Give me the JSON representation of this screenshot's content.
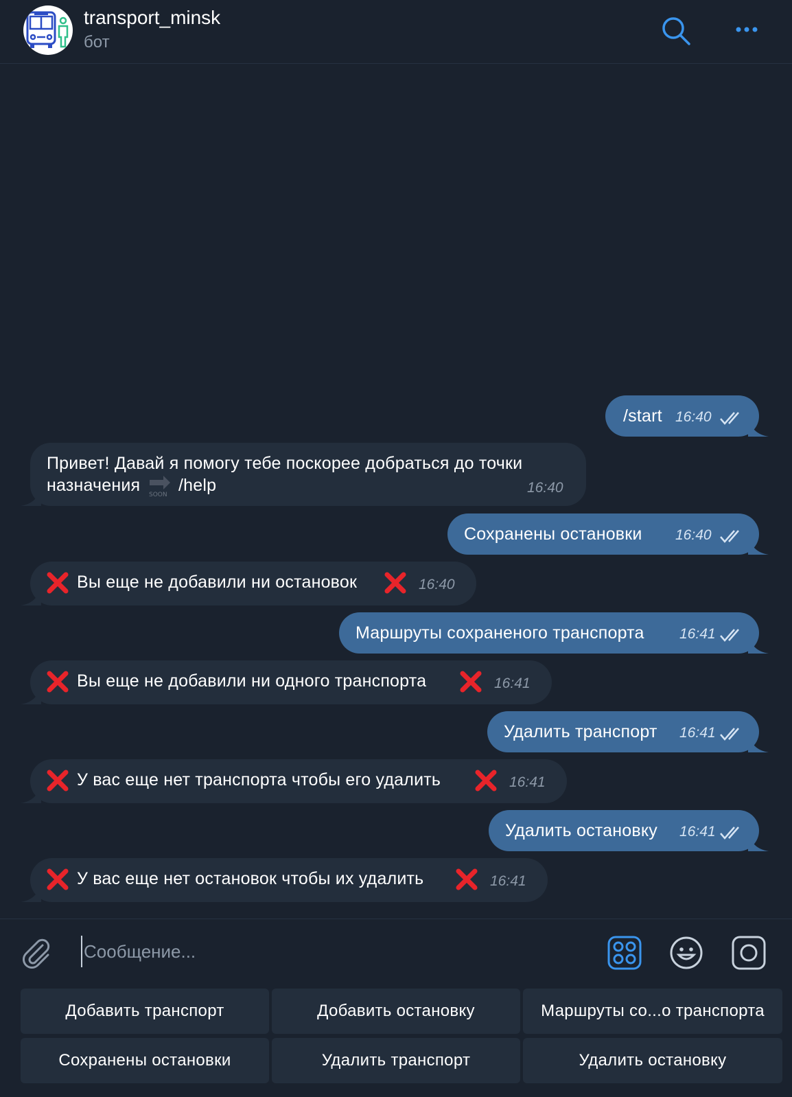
{
  "header": {
    "title": "transport_minsk",
    "subtitle": "бот",
    "search_icon": "search-icon",
    "more_icon": "more-dots-icon"
  },
  "messages": [
    {
      "dir": "out",
      "text": "/start",
      "time": "16:40",
      "is_command": true
    },
    {
      "dir": "in",
      "line1": "Привет! Давай я помогу тебе поскорее добраться до точки",
      "line2": "назначения",
      "emoji": "soon-arrow-emoji",
      "emoji_text": "SOON",
      "link": "/help",
      "time": "16:40"
    },
    {
      "dir": "out",
      "text": "Сохранены остановки",
      "time": "16:40"
    },
    {
      "dir": "in",
      "text": "Вы еще не добавили ни остановок",
      "time": "16:40"
    },
    {
      "dir": "out",
      "text": "Маршруты сохраненого транспорта",
      "time": "16:41"
    },
    {
      "dir": "in",
      "text": "Вы еще не добавили ни одного транспорта",
      "time": "16:41"
    },
    {
      "dir": "out",
      "text": "Удалить транспорт",
      "time": "16:41"
    },
    {
      "dir": "in",
      "text": "У вас еще нет транспорта чтобы его удалить",
      "time": "16:41"
    },
    {
      "dir": "out",
      "text": "Удалить остановку",
      "time": "16:41"
    },
    {
      "dir": "in",
      "text": "У вас еще нет остановок чтобы их удалить",
      "time": "16:41"
    }
  ],
  "composer": {
    "placeholder": "Сообщение...",
    "attach_icon": "paperclip-icon",
    "commands_icon": "bot-commands-icon",
    "emoji_icon": "emoji-icon",
    "sticker_icon": "sticker-icon"
  },
  "keyboard": [
    [
      "Добавить транспорт",
      "Добавить остановку",
      "Маршруты со...о транспорта"
    ],
    [
      "Сохранены остановки",
      "Удалить транспорт",
      "Удалить остановку"
    ]
  ],
  "colors": {
    "background": "#1a222e",
    "outgoing_bubble": "#3d6a99",
    "incoming_bubble": "#232e3c",
    "link": "#6fb8ff",
    "accent": "#3a95ee",
    "cross": "#e8242a"
  }
}
